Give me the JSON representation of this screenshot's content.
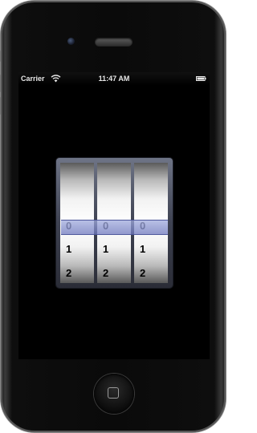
{
  "status_bar": {
    "carrier": "Carrier",
    "time": "11:47 AM",
    "wifi_icon": "wifi-icon",
    "battery_icon": "battery-icon"
  },
  "picker": {
    "wheels": [
      {
        "selected": "0",
        "next": "1",
        "after": "2"
      },
      {
        "selected": "0",
        "next": "1",
        "after": "2"
      },
      {
        "selected": "0",
        "next": "1",
        "after": "2"
      }
    ],
    "selection_color": "#8c96d2"
  },
  "device": {
    "home_button_icon": "home-button-icon"
  }
}
